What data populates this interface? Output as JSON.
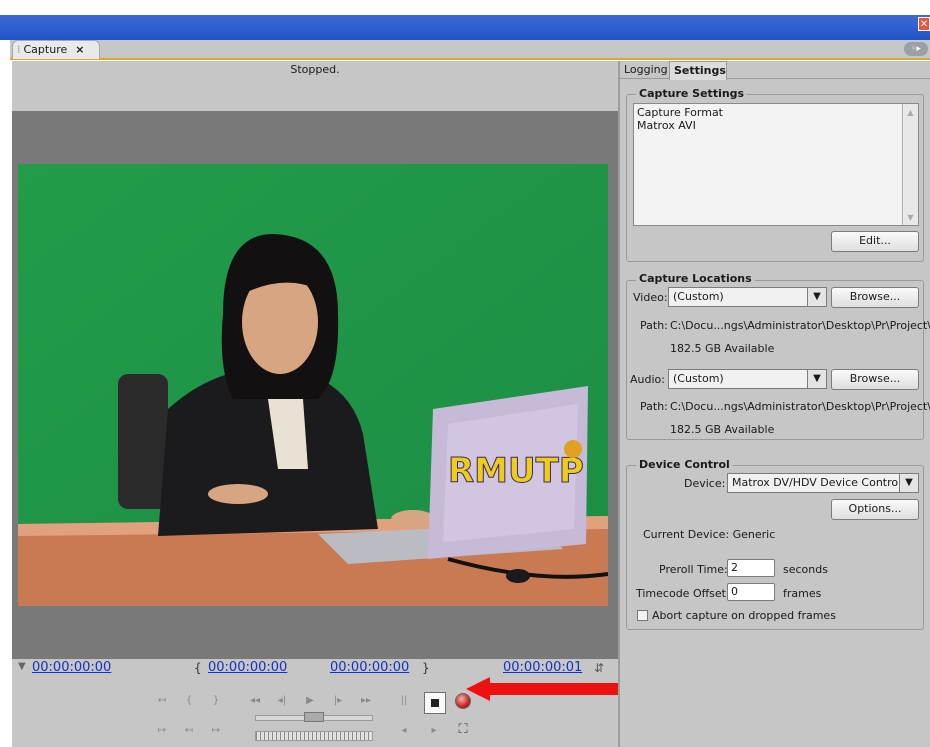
{
  "window": {
    "close_glyph": "✕"
  },
  "tabs": {
    "capture_label": "Capture",
    "capture_close": "×",
    "panel_menu": "◦▸"
  },
  "monitor": {
    "status": "Stopped."
  },
  "timecodes": {
    "in_point": "00:00:00:00",
    "out_point": "00:00:00:00",
    "current": "00:00:00:00",
    "duration": "00:00:00:01"
  },
  "transport": {
    "set_in": "↤",
    "set_out": "↦",
    "go_in": "{",
    "go_out": "}",
    "rewind": "◂◂",
    "step_back": "◂|",
    "play": "▶",
    "step_forward": "|▸",
    "fast_forward": "▸▸",
    "pause": "||",
    "scene_search_left": "◂",
    "scene_search_right": "▸"
  },
  "right_panel": {
    "tabs": [
      "Logging",
      "Settings"
    ],
    "capture_settings": {
      "title": "Capture Settings",
      "format_label": "Capture Format",
      "format_value": "Matrox AVI",
      "edit_button": "Edit..."
    },
    "capture_locations": {
      "title": "Capture Locations",
      "video_label": "Video:",
      "video_value": "(Custom)",
      "video_browse": "Browse...",
      "video_path_label": "Path:",
      "video_path": "C:\\Docu...ngs\\Administrator\\Desktop\\Pr\\Project\\",
      "video_available": "182.5 GB Available",
      "audio_label": "Audio:",
      "audio_value": "(Custom)",
      "audio_browse": "Browse...",
      "audio_path_label": "Path:",
      "audio_path": "C:\\Docu...ngs\\Administrator\\Desktop\\Pr\\Project\\",
      "audio_available": "182.5 GB Available"
    },
    "device_control": {
      "title": "Device Control",
      "device_label": "Device:",
      "device_value": "Matrox DV/HDV Device Control",
      "options_button": "Options...",
      "current_device": "Current Device:  Generic",
      "preroll_label": "Preroll Time:",
      "preroll_value": "2",
      "preroll_unit": "seconds",
      "timecode_offset_label": "Timecode Offset:",
      "timecode_offset_value": "0",
      "timecode_offset_unit": "frames",
      "abort_label": "Abort capture on dropped frames",
      "abort_checked": false
    }
  },
  "colors": {
    "accent_tab": "#e7a525",
    "timecode": "#1430c6",
    "arrow": "#ef1111"
  }
}
